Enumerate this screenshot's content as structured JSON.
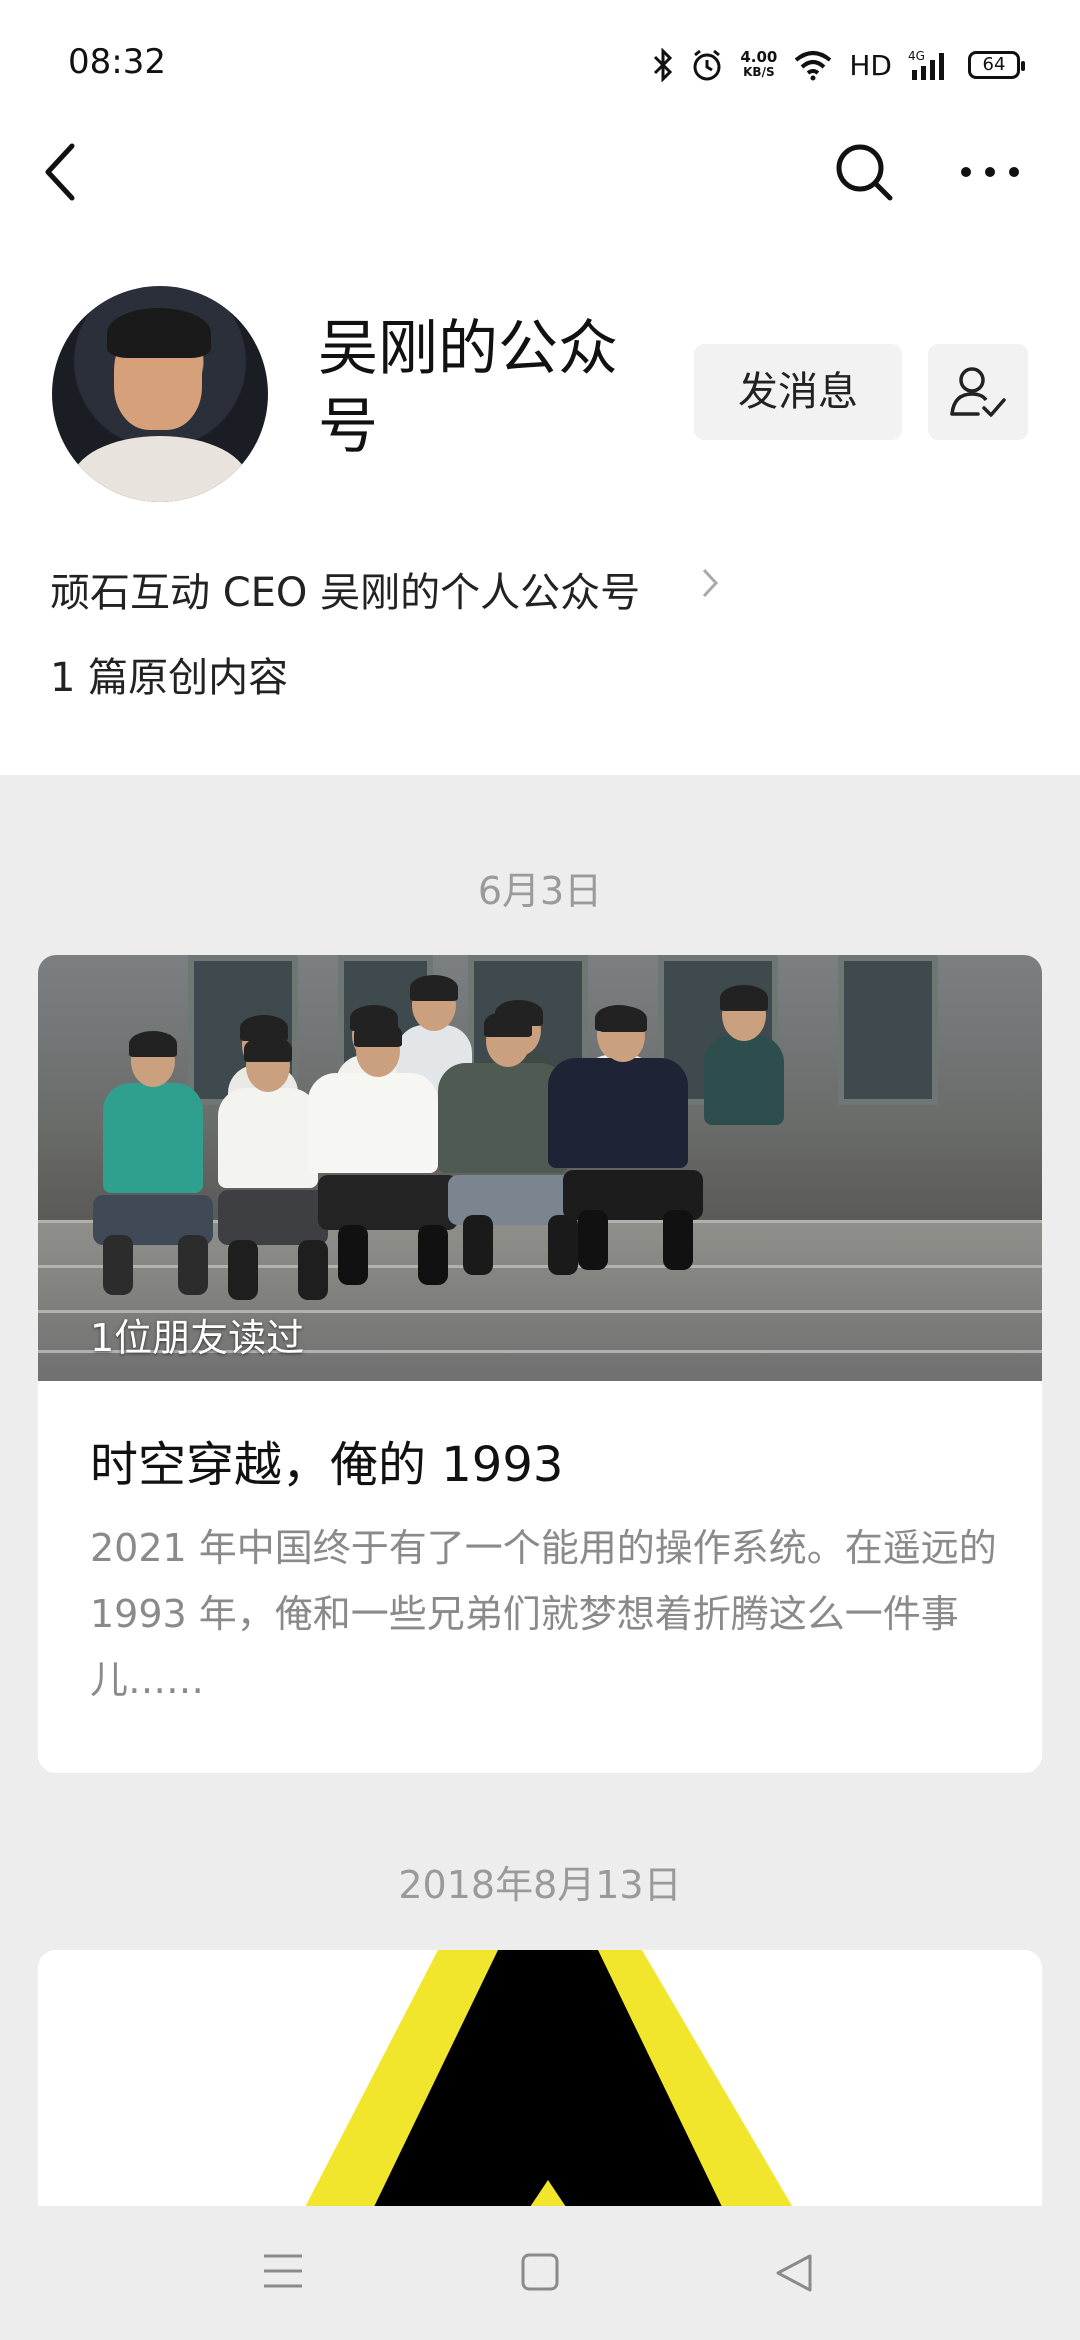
{
  "status_bar": {
    "time": "08:32",
    "speed_value": "4.00",
    "speed_unit": "KB/S",
    "network": "HD",
    "signal_type": "4G",
    "battery": "64"
  },
  "nav": {
    "back_icon": "chevron-left-icon",
    "search_icon": "search-icon",
    "more_icon": "more-dots-icon"
  },
  "profile": {
    "name": "吴刚的公众号",
    "message_button": "发消息",
    "description": "顽石互动 CEO 吴刚的个人公众号",
    "original_count": "1 篇原创内容"
  },
  "feed": [
    {
      "date": "6月3日",
      "read_by": "1位朋友读过",
      "title": "时空穿越，俺的 1993",
      "digest": "2021 年中国终于有了一个能用的操作系统。在遥远的 1993 年，俺和一些兄弟们就梦想着折腾这么一件事儿……"
    },
    {
      "date": "2018年8月13日"
    }
  ],
  "system_nav": {
    "menu_icon": "menu-icon",
    "home_icon": "home-square-icon",
    "back_icon": "back-triangle-icon"
  },
  "colors": {
    "background": "#ededed",
    "card": "#ffffff",
    "secondary_text": "#8a8a8a",
    "button_bg": "#f2f2f2"
  }
}
